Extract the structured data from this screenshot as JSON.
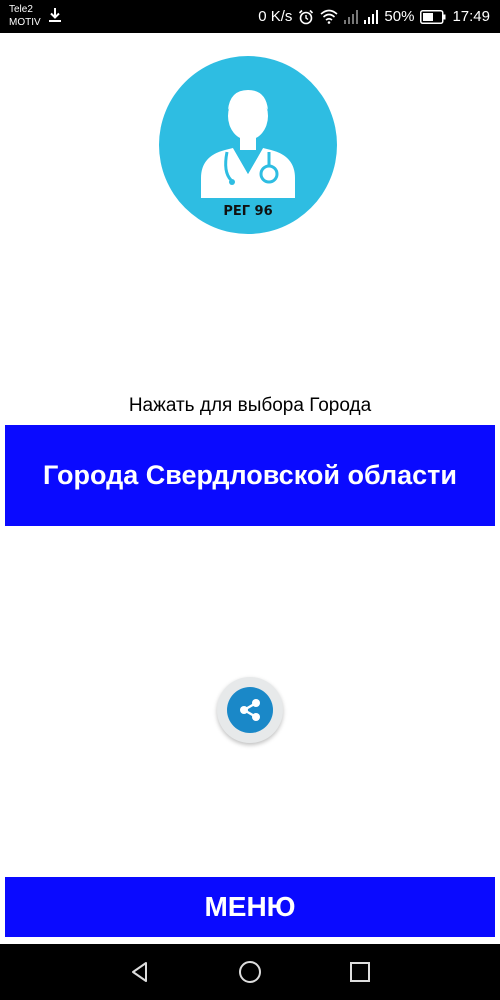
{
  "status_bar": {
    "carrier_line1": "Tele2",
    "carrier_line2": "MOTIV",
    "net_speed": "0 K/s",
    "battery_percent": "50%",
    "time": "17:49",
    "icons": [
      "download-icon",
      "alarm-icon",
      "wifi-icon",
      "signal-icon",
      "signal-icon",
      "battery-icon"
    ]
  },
  "logo": {
    "label": "РЕГ 96",
    "icon": "doctor-icon",
    "color": "#2ebde2"
  },
  "main": {
    "hint": "Нажать для выбора Города",
    "city_button_label": "Города Свердловской области",
    "share_icon": "share-icon"
  },
  "menu": {
    "button_label": "МЕНЮ"
  },
  "nav_bar": {
    "icons": [
      "back-icon",
      "home-icon",
      "recents-icon"
    ]
  },
  "colors": {
    "button_blue": "#0a0aff",
    "logo_blue": "#2ebde2",
    "share_blue": "#1a88c8",
    "bars": "#000000"
  }
}
